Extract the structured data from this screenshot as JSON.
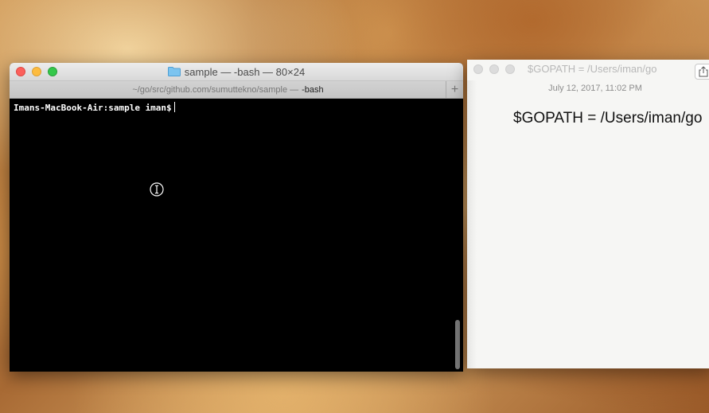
{
  "terminal": {
    "title": "sample — -bash — 80×24",
    "tab_path": "~/go/src/github.com/sumuttekno/sample —",
    "tab_process": "-bash",
    "new_tab_label": "+",
    "prompt": "Imans-MacBook-Air:sample iman$",
    "folder_color": "#7cc4f0",
    "background_color": "#000000"
  },
  "notes": {
    "title": "$GOPATH = /Users/iman/go",
    "date": "July 12, 2017, 11:02 PM",
    "heading": "$GOPATH = /Users/iman/go"
  },
  "icons": {
    "folder": "folder-icon",
    "share": "share-icon",
    "mouse": "mouse-pointer-icon"
  },
  "colors": {
    "close": "#fc605c",
    "minimize": "#fdbc40",
    "maximize": "#34c84a"
  }
}
